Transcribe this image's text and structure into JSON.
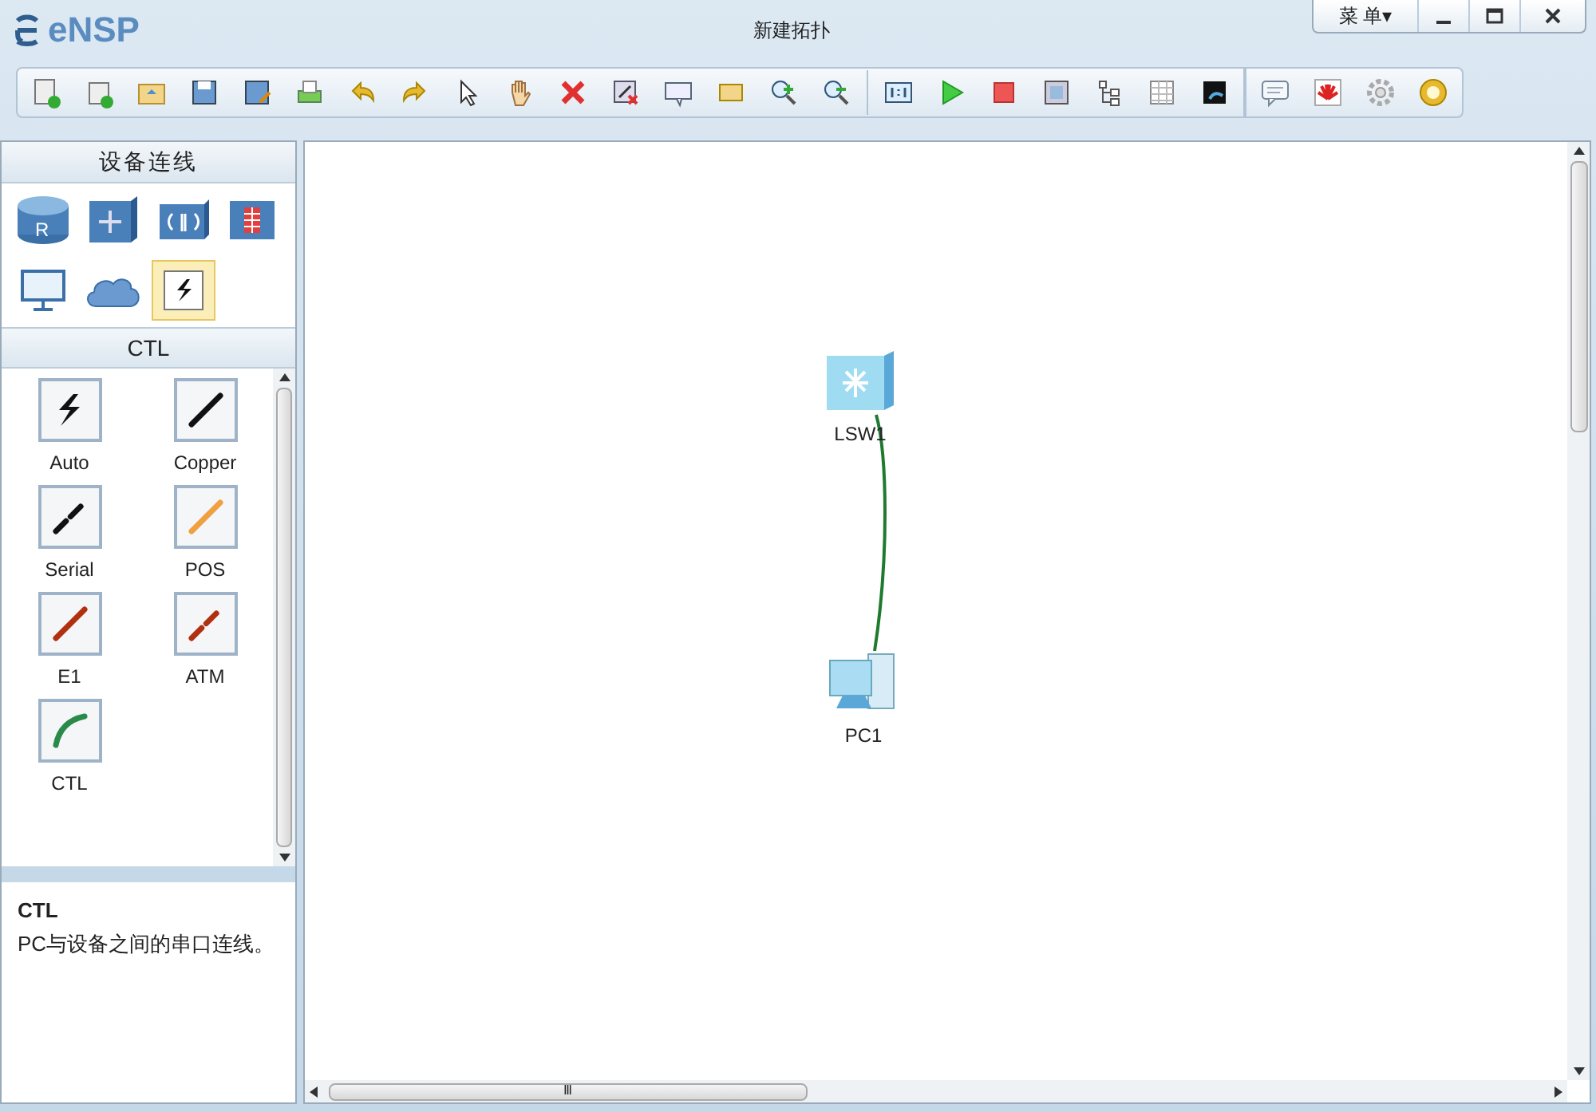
{
  "app": {
    "logo": "eNSP",
    "title": "新建拓扑",
    "menu_button": "菜 单▾"
  },
  "device_panel": {
    "title": "设备连线",
    "categories": [
      {
        "kind": "router",
        "selected": false,
        "badge": "R"
      },
      {
        "kind": "switch",
        "selected": false
      },
      {
        "kind": "wireless",
        "selected": false
      },
      {
        "kind": "firewall",
        "selected": false
      },
      {
        "kind": "terminal",
        "selected": false
      },
      {
        "kind": "cloud",
        "selected": false
      },
      {
        "kind": "link",
        "selected": true
      }
    ]
  },
  "link_panel": {
    "title": "CTL",
    "items": [
      {
        "label": "Auto",
        "kind": "auto",
        "color": "#111111"
      },
      {
        "label": "Copper",
        "kind": "solid",
        "color": "#111111"
      },
      {
        "label": "Serial",
        "kind": "dashed",
        "color": "#111111"
      },
      {
        "label": "POS",
        "kind": "solid",
        "color": "#f0a040"
      },
      {
        "label": "E1",
        "kind": "solid",
        "color": "#b03010"
      },
      {
        "label": "ATM",
        "kind": "dashed",
        "color": "#b03010"
      },
      {
        "label": "CTL",
        "kind": "curve",
        "color": "#2a8a4a"
      }
    ]
  },
  "description": {
    "title": "CTL",
    "text": "PC与设备之间的串口连线。"
  },
  "canvas": {
    "nodes": [
      {
        "kind": "switch",
        "label": "LSW1"
      },
      {
        "kind": "pc",
        "label": "PC1"
      }
    ]
  },
  "scroll_grip": "Ⅲ"
}
